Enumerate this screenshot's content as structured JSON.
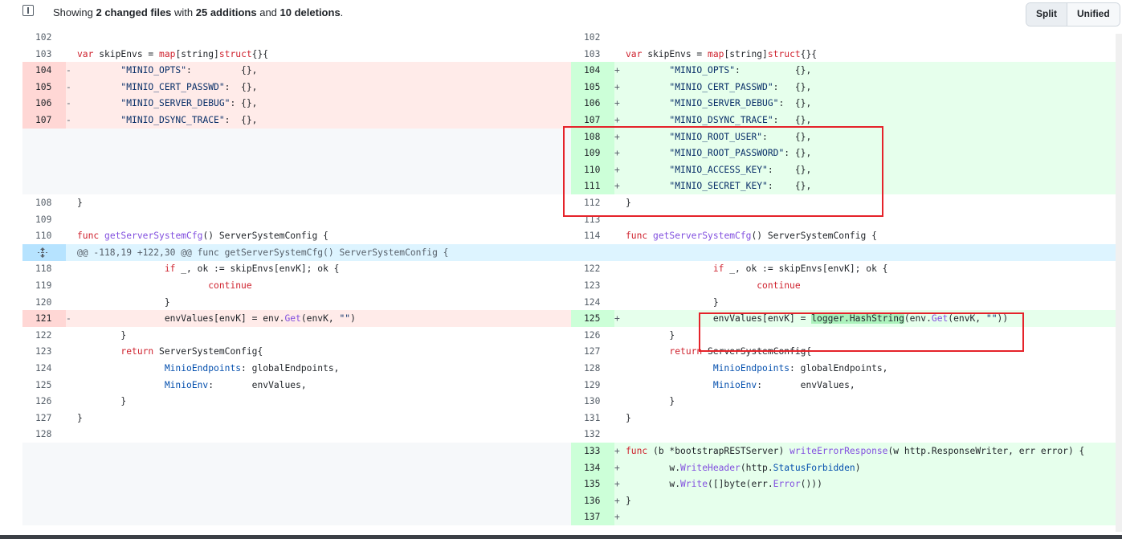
{
  "toolbar": {
    "summary_prefix": "Showing ",
    "changed_files": "2 changed files",
    "summary_with": " with ",
    "additions": "25 additions",
    "summary_and": " and ",
    "deletions": "10 deletions",
    "summary_end": ".",
    "split_label": "Split",
    "unified_label": "Unified"
  },
  "hunk_header": "@@ -118,19 +122,30 @@ func getServerSystemCfg() ServerSystemConfig {",
  "left": [
    {
      "num": "102",
      "sign": "",
      "code": ""
    },
    {
      "num": "103",
      "sign": "",
      "code": "var skipEnvs = map[string]struct{}{"
    },
    {
      "num": "104",
      "sign": "-",
      "code": "        \"MINIO_OPTS\":         {},"
    },
    {
      "num": "105",
      "sign": "-",
      "code": "        \"MINIO_CERT_PASSWD\":  {},"
    },
    {
      "num": "106",
      "sign": "-",
      "code": "        \"MINIO_SERVER_DEBUG\": {},"
    },
    {
      "num": "107",
      "sign": "-",
      "code": "        \"MINIO_DSYNC_TRACE\":  {},"
    },
    {
      "num": "108",
      "sign": "",
      "code": "}"
    },
    {
      "num": "109",
      "sign": "",
      "code": ""
    },
    {
      "num": "110",
      "sign": "",
      "code": "func getServerSystemCfg() ServerSystemConfig {"
    },
    {
      "num": "118",
      "sign": "",
      "code": "                if _, ok := skipEnvs[envK]; ok {"
    },
    {
      "num": "119",
      "sign": "",
      "code": "                        continue"
    },
    {
      "num": "120",
      "sign": "",
      "code": "                }"
    },
    {
      "num": "121",
      "sign": "-",
      "code": "                envValues[envK] = env.Get(envK, \"\")"
    },
    {
      "num": "122",
      "sign": "",
      "code": "        }"
    },
    {
      "num": "123",
      "sign": "",
      "code": "        return ServerSystemConfig{"
    },
    {
      "num": "124",
      "sign": "",
      "code": "                MinioEndpoints: globalEndpoints,"
    },
    {
      "num": "125",
      "sign": "",
      "code": "                MinioEnv:       envValues,"
    },
    {
      "num": "126",
      "sign": "",
      "code": "        }"
    },
    {
      "num": "127",
      "sign": "",
      "code": "}"
    },
    {
      "num": "128",
      "sign": "",
      "code": ""
    }
  ],
  "right": [
    {
      "num": "102",
      "sign": "",
      "code": ""
    },
    {
      "num": "103",
      "sign": "",
      "code": "var skipEnvs = map[string]struct{}{"
    },
    {
      "num": "104",
      "sign": "+",
      "code": "        \"MINIO_OPTS\":          {},"
    },
    {
      "num": "105",
      "sign": "+",
      "code": "        \"MINIO_CERT_PASSWD\":   {},"
    },
    {
      "num": "106",
      "sign": "+",
      "code": "        \"MINIO_SERVER_DEBUG\":  {},"
    },
    {
      "num": "107",
      "sign": "+",
      "code": "        \"MINIO_DSYNC_TRACE\":   {},"
    },
    {
      "num": "108",
      "sign": "+",
      "code": "        \"MINIO_ROOT_USER\":     {},"
    },
    {
      "num": "109",
      "sign": "+",
      "code": "        \"MINIO_ROOT_PASSWORD\": {},"
    },
    {
      "num": "110",
      "sign": "+",
      "code": "        \"MINIO_ACCESS_KEY\":    {},"
    },
    {
      "num": "111",
      "sign": "+",
      "code": "        \"MINIO_SECRET_KEY\":    {},"
    },
    {
      "num": "112",
      "sign": "",
      "code": "}"
    },
    {
      "num": "113",
      "sign": "",
      "code": ""
    },
    {
      "num": "114",
      "sign": "",
      "code": "func getServerSystemCfg() ServerSystemConfig {"
    },
    {
      "num": "122",
      "sign": "",
      "code": "                if _, ok := skipEnvs[envK]; ok {"
    },
    {
      "num": "123",
      "sign": "",
      "code": "                        continue"
    },
    {
      "num": "124",
      "sign": "",
      "code": "                }"
    },
    {
      "num": "125",
      "sign": "+",
      "code": "                envValues[envK] = logger.HashString(env.Get(envK, \"\"))"
    },
    {
      "num": "126",
      "sign": "",
      "code": "        }"
    },
    {
      "num": "127",
      "sign": "",
      "code": "        return ServerSystemConfig{"
    },
    {
      "num": "128",
      "sign": "",
      "code": "                MinioEndpoints: globalEndpoints,"
    },
    {
      "num": "129",
      "sign": "",
      "code": "                MinioEnv:       envValues,"
    },
    {
      "num": "130",
      "sign": "",
      "code": "        }"
    },
    {
      "num": "131",
      "sign": "",
      "code": "}"
    },
    {
      "num": "132",
      "sign": "",
      "code": ""
    },
    {
      "num": "133",
      "sign": "+",
      "code": "func (b *bootstrapRESTServer) writeErrorResponse(w http.ResponseWriter, err error) {"
    },
    {
      "num": "134",
      "sign": "+",
      "code": "        w.WriteHeader(http.StatusForbidden)"
    },
    {
      "num": "135",
      "sign": "+",
      "code": "        w.Write([]byte(err.Error()))"
    },
    {
      "num": "136",
      "sign": "+",
      "code": "}"
    },
    {
      "num": "137",
      "sign": "+",
      "code": ""
    }
  ]
}
